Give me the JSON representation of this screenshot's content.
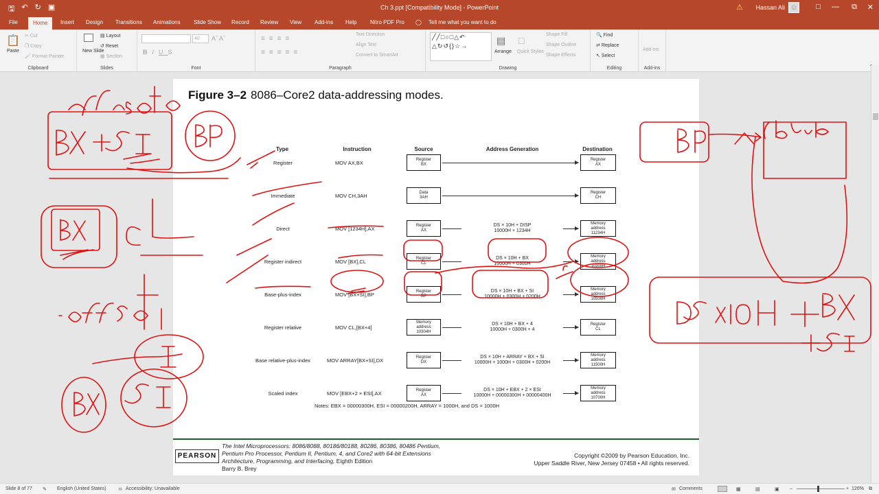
{
  "window": {
    "title": "Ch 3.ppt [Compatibility Mode] - PowerPoint",
    "user": "Hassan Ali"
  },
  "qat": {
    "save_icon": "save-icon",
    "undo_icon": "undo-icon",
    "redo_icon": "redo-icon",
    "present_icon": "present-icon"
  },
  "tabs": [
    "File",
    "Home",
    "Insert",
    "Design",
    "Transitions",
    "Animations",
    "Slide Show",
    "Record",
    "Review",
    "View",
    "Add-ins",
    "Help",
    "Nitro PDF Pro"
  ],
  "tell_me": "Tell me what you want to do",
  "ribbon": {
    "clipboard": {
      "label": "Clipboard",
      "paste": "Paste",
      "cut": "Cut",
      "copy": "Copy",
      "format_painter": "Format Painter"
    },
    "slides": {
      "label": "Slides",
      "new_slide": "New Slide",
      "layout": "Layout",
      "reset": "Reset",
      "section": "Section"
    },
    "font": {
      "label": "Font",
      "size": "40"
    },
    "paragraph": {
      "label": "Paragraph",
      "text_direction": "Text Direction",
      "align_text": "Align Text",
      "convert": "Convert to SmartArt"
    },
    "drawing": {
      "label": "Drawing",
      "arrange": "Arrange",
      "quick_styles": "Quick Styles",
      "shape_fill": "Shape Fill",
      "shape_outline": "Shape Outline",
      "shape_effects": "Shape Effects"
    },
    "editing": {
      "label": "Editing",
      "find": "Find",
      "replace": "Replace",
      "select": "Select"
    },
    "addins": {
      "label": "Add-ins",
      "addins": "Add-ins"
    }
  },
  "slide": {
    "figure_label": "Figure 3–2",
    "figure_title": "8086–Core2 data-addressing modes.",
    "headers": {
      "type": "Type",
      "instruction": "Instruction",
      "source": "Source",
      "address_generation": "Address Generation",
      "destination": "Destination"
    },
    "rows": [
      {
        "type": "Register",
        "instruction": "MOV  AX,BX",
        "source": [
          "Register",
          "BX"
        ],
        "addr": [],
        "dest": [
          "Register",
          "AX"
        ]
      },
      {
        "type": "Immediate",
        "instruction": "MOV  CH,3AH",
        "source": [
          "Data",
          "3AH"
        ],
        "addr": [],
        "dest": [
          "Register",
          "CH"
        ]
      },
      {
        "type": "Direct",
        "instruction": "MOV  [1234H],AX",
        "source": [
          "Register",
          "AX"
        ],
        "addr": [
          "DS × 10H + DISP",
          "10000H + 1234H"
        ],
        "dest": [
          "Memory",
          "address",
          "11234H"
        ]
      },
      {
        "type": "Register indirect",
        "instruction": "MOV  [BX],CL",
        "source": [
          "Register",
          "CL"
        ],
        "addr": [
          "DS × 10H + BX",
          "10000H + 0300H"
        ],
        "dest": [
          "Memory",
          "address",
          "10300H"
        ]
      },
      {
        "type": "Base-plus-index",
        "instruction": "MOV  [BX+SI],BP",
        "source": [
          "Register",
          "BP"
        ],
        "addr": [
          "DS × 10H + BX + SI",
          "10000H + 0300H + 0200H"
        ],
        "dest": [
          "Memory",
          "address",
          "10500H"
        ]
      },
      {
        "type": "Register relative",
        "instruction": "MOV  CL,[BX+4]",
        "source": [
          "Memory",
          "address",
          "10304H"
        ],
        "addr": [
          "DS × 10H + BX + 4",
          "10000H + 0300H + 4"
        ],
        "dest": [
          "Register",
          "CL"
        ]
      },
      {
        "type": "Base relative-plus-index",
        "instruction": "MOV  ARRAY[BX+SI],DX",
        "source": [
          "Register",
          "DX"
        ],
        "addr": [
          "DS × 10H + ARRAY + BX + SI",
          "10000H + 1000H + 0300H + 0200H"
        ],
        "dest": [
          "Memory",
          "address",
          "11500H"
        ]
      },
      {
        "type": "Scaled index",
        "instruction": "MOV  [EBX+2 × ESI],AX",
        "source": [
          "Register",
          "AX"
        ],
        "addr": [
          "DS × 10H + EBX + 2 × ESI",
          "10000H + 00000300H + 00000400H"
        ],
        "dest": [
          "Memory",
          "address",
          "10700H"
        ]
      }
    ],
    "notes": "Notes:  EBX = 00000300H, ESI = 00000200H, ARRAY = 1000H, and DS = 1000H",
    "publisher": "PEARSON",
    "book_lines": [
      "The Intel Microprocessors: 8086/8088, 80186/80188, 80286, 80386, 80486 Pentium,",
      "Pentium Pro Processor, Pentium II, Pentium, 4, and Core2 with 64-bit Extensions",
      "Architecture, Programming, and Interfacing,"
    ],
    "edition": "Eighth Edition",
    "author": "Barry B. Brey",
    "copyright": [
      "Copyright ©2009 by Pearson Education, Inc.",
      "Upper Saddle River, New Jersey 07458 • All rights reserved."
    ]
  },
  "status": {
    "slide": "Slide 8 of 77",
    "language": "English (United States)",
    "accessibility": "Accessibility: Unavailable",
    "comments": "Comments",
    "zoom": "120%"
  },
  "colors": {
    "accent": "#b7472a",
    "ink": "#e01010"
  }
}
